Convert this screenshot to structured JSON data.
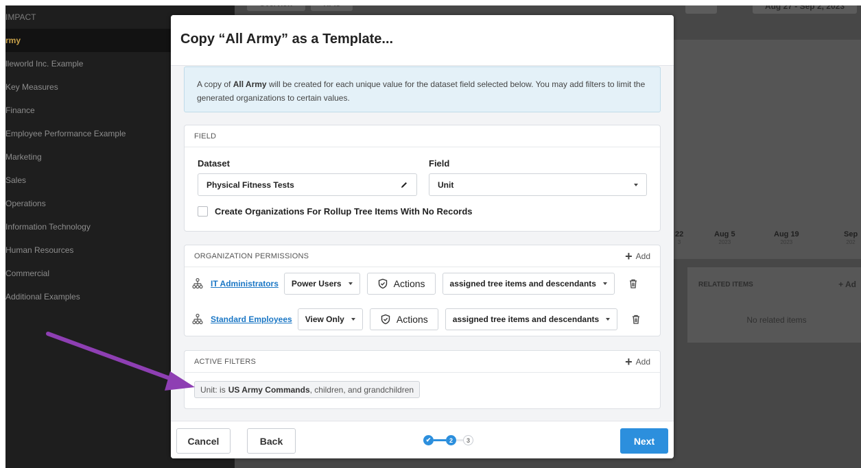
{
  "background": {
    "sidebar": {
      "items": [
        {
          "label": "IMPACT",
          "kind": "header"
        },
        {
          "label": "rmy",
          "kind": "active"
        },
        {
          "label": "lleworld Inc. Example"
        },
        {
          "label": "Key Measures"
        },
        {
          "label": "Finance"
        },
        {
          "label": "Employee Performance Example"
        },
        {
          "label": "Marketing"
        },
        {
          "label": "Sales"
        },
        {
          "label": "Operations"
        },
        {
          "label": "Information Technology"
        },
        {
          "label": "Human Resources"
        },
        {
          "label": "Commercial"
        },
        {
          "label": "Additional Examples"
        }
      ]
    },
    "top_tabs": [
      "Overview",
      "KPIs"
    ],
    "date_range": "Aug 27 - Sep 2, 2023",
    "chart_ticks": [
      {
        "label": "22",
        "year": "3"
      },
      {
        "label": "Aug 5",
        "year": "2023"
      },
      {
        "label": "Aug 19",
        "year": "2023"
      },
      {
        "label": "Sep",
        "year": "202"
      }
    ],
    "related": {
      "title": "RELATED ITEMS",
      "add": "+ Ad",
      "empty": "No related items"
    }
  },
  "modal": {
    "title": "Copy “All Army” as a Template...",
    "info": {
      "prefix": "A copy of ",
      "org_name": "All Army",
      "suffix": " will be created for each unique value for the dataset field selected below. You may add filters to limit the generated organizations to certain values."
    },
    "field_section": {
      "title": "FIELD",
      "dataset_label": "Dataset",
      "dataset_value": "Physical Fitness Tests",
      "field_label": "Field",
      "field_value": "Unit",
      "checkbox_label": "Create Organizations For Rollup Tree Items With No Records",
      "checkbox_checked": false
    },
    "permissions": {
      "title": "ORGANIZATION PERMISSIONS",
      "add_label": "Add",
      "rows": [
        {
          "group": "IT Administrators",
          "role": "Power Users",
          "actions": "Actions",
          "scope": "assigned tree items and descendants"
        },
        {
          "group": "Standard Employees",
          "role": "View Only",
          "actions": "Actions",
          "scope": "assigned tree items and descendants"
        }
      ]
    },
    "filters": {
      "title": "ACTIVE FILTERS",
      "add_label": "Add",
      "chip": {
        "field": "Unit:",
        "op": "is",
        "value": "US Army Commands",
        "suffix": ", children, and grandchildren"
      }
    },
    "footer": {
      "cancel": "Cancel",
      "back": "Back",
      "next": "Next",
      "steps": {
        "current": 2,
        "total": 3,
        "labels": [
          "✔",
          "2",
          "3"
        ]
      }
    }
  },
  "colors": {
    "accent": "#2c8fdd",
    "link": "#1b77c5",
    "arrow": "#8e3fb3",
    "info_bg": "#e4f1f8"
  }
}
